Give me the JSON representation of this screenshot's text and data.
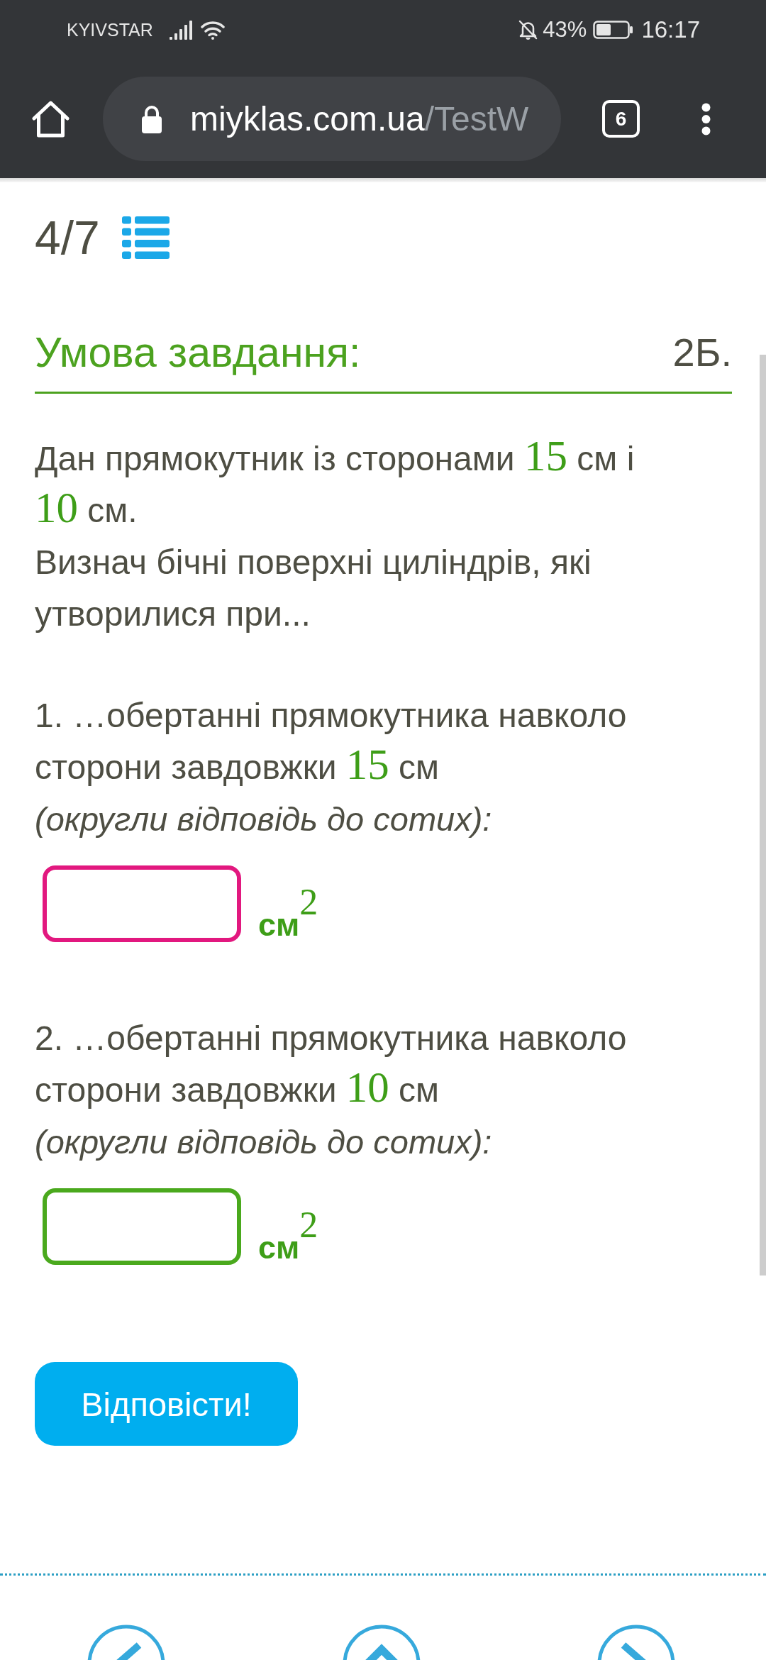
{
  "status_bar": {
    "carrier": "KYIVSTAR",
    "battery": "43%",
    "time": "16:17"
  },
  "browser": {
    "url_host": "miyklas.com.ua",
    "url_path": "/TestW",
    "tab_count": "6"
  },
  "progress": {
    "counter": "4/7"
  },
  "task": {
    "heading": "Умова завдання:",
    "points": "2Б.",
    "intro": [
      {
        "lines": [
          [
            {
              "kind": "text",
              "text": "Дан прямокутник із сторонами "
            },
            {
              "kind": "math",
              "text": "15"
            },
            {
              "kind": "text",
              "text": " см і"
            }
          ],
          [
            {
              "kind": "math",
              "text": "10"
            },
            {
              "kind": "text",
              "text": " см."
            }
          ]
        ]
      },
      {
        "lines": [
          [
            {
              "kind": "text",
              "text": "Визнач бічні поверхні циліндрів, які"
            }
          ],
          [
            {
              "kind": "text",
              "text": "утворилися при..."
            }
          ]
        ]
      }
    ],
    "questions": [
      {
        "lines": [
          [
            {
              "kind": "text",
              "text": "1. …обертанні прямокутника навколо"
            }
          ],
          [
            {
              "kind": "text",
              "text": "сторони завдовжки "
            },
            {
              "kind": "math",
              "text": "15"
            },
            {
              "kind": "text",
              "text": " см"
            }
          ]
        ],
        "hint": "(округли відповідь до сотих):",
        "answer": {
          "focused": true
        },
        "unit": "см$^{2}$"
      },
      {
        "lines": [
          [
            {
              "kind": "text",
              "text": "2. …обертанні прямокутника навколо"
            }
          ],
          [
            {
              "kind": "text",
              "text": "сторони завдовжки "
            },
            {
              "kind": "math",
              "text": "10"
            },
            {
              "kind": "text",
              "text": " см"
            }
          ]
        ],
        "hint": "(округли відповідь до сотих):",
        "answer": {
          "focused": false
        },
        "unit": "см$^{2}$"
      }
    ]
  },
  "submit_button": "Відповісти!"
}
